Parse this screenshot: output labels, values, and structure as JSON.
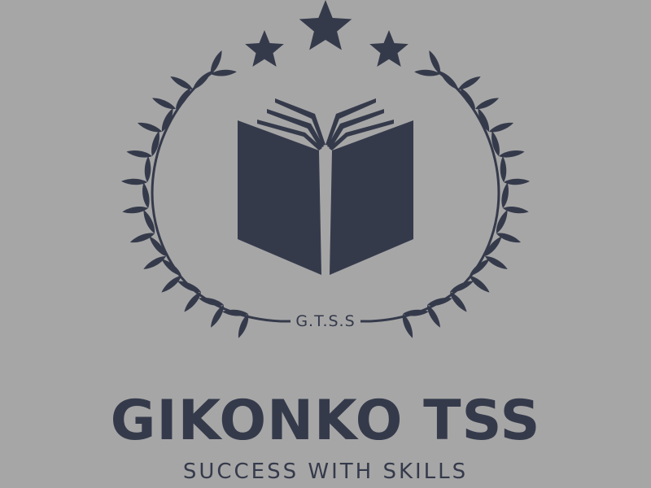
{
  "logo": {
    "acronym": "G.T.S.S",
    "title": "GIKONKO TSS",
    "tagline": "SUCCESS WITH SKILLS",
    "background_color": "#a6a6a6",
    "ink_color": "#353a4b",
    "star_count": 3,
    "icons": [
      "star-icon",
      "open-book-icon",
      "laurel-wreath-icon"
    ]
  }
}
